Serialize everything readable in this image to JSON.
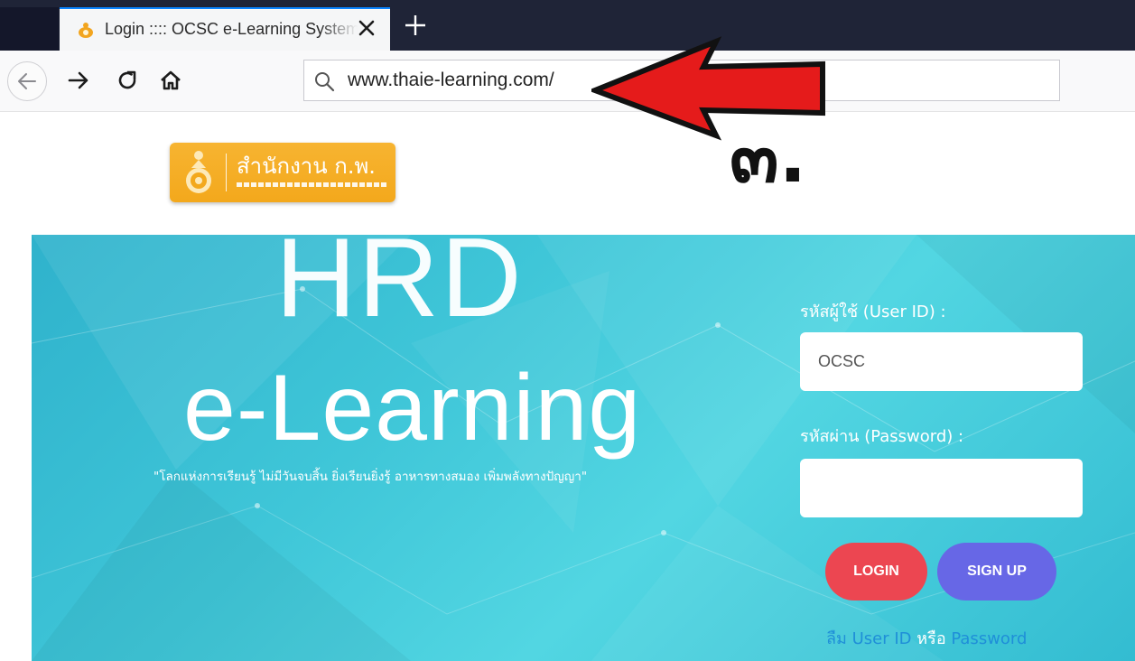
{
  "browser": {
    "tab_title": "Login :::: OCSC e-Learning System",
    "url": "www.thaie-learning.com/"
  },
  "logo": {
    "text": "สำนักงาน ก.พ."
  },
  "annotation": {
    "label": "๓.",
    "arrow_color": "#e51b1b"
  },
  "hero": {
    "title_line1": "HRD",
    "title_line2": "e-Learning",
    "slogan": "\"โลกแห่งการเรียนรู้ ไม่มีวันจบสิ้น ยิ่งเรียนยิ่งรู้ อาหารทางสมอง เพิ่มพลังทางปัญญา\""
  },
  "login_form": {
    "user_label": "รหัสผู้ใช้ (User ID) :",
    "user_value": "OCSC",
    "password_label": "รหัสผ่าน (Password) :",
    "password_value": "",
    "login_button": "LOGIN",
    "signup_button": "SIGN UP",
    "forgot_prefix": "ลืม User ID",
    "forgot_or": "หรือ",
    "forgot_suffix": "Password"
  },
  "colors": {
    "hero_bg": "#3fc6d8",
    "login_btn": "#ec4651",
    "signup_btn": "#6767e6",
    "logo_bg": "#f5ae26"
  }
}
